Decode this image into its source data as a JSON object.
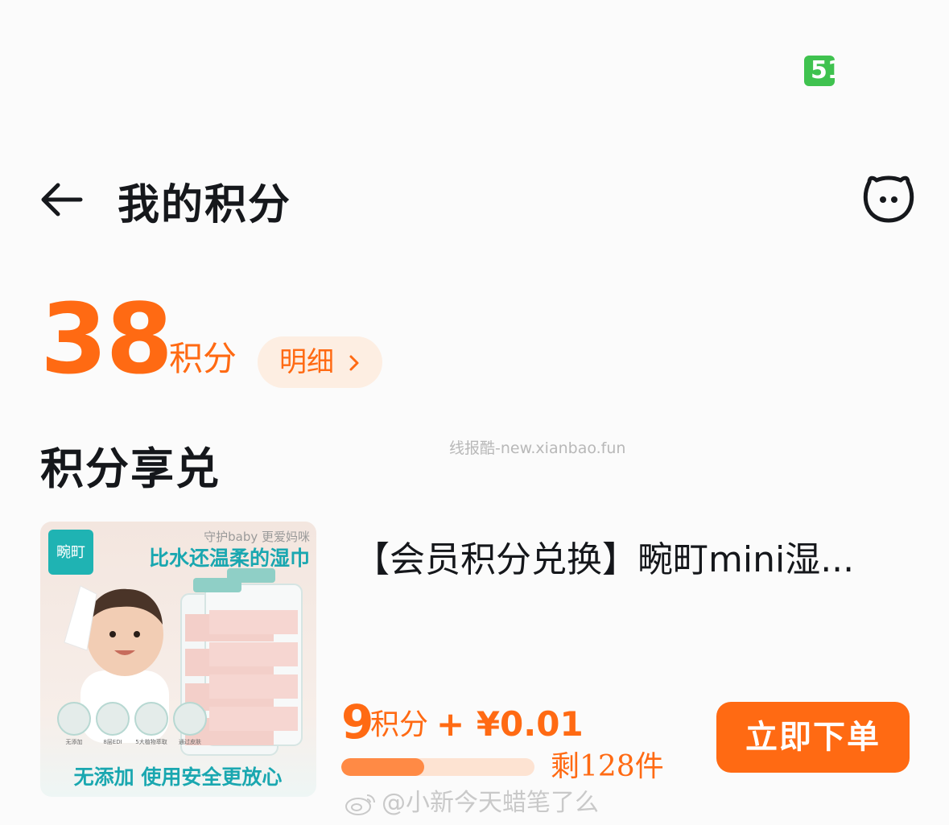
{
  "status_bar": {
    "badge": "51"
  },
  "header": {
    "title": "我的积分",
    "back_icon": "back-arrow-icon",
    "service_icon": "service-face-icon"
  },
  "points": {
    "value": "38",
    "unit": "积分",
    "detail_label": "明细"
  },
  "watermark_top": "线报酷-new.xianbao.fun",
  "section": {
    "title": "积分享兑"
  },
  "product": {
    "image_texts": {
      "brand": "畹町",
      "slogan": "守护baby 更爱妈咪",
      "headline": "比水还温柔的湿巾",
      "bottom": "无添加 使用安全更放心",
      "features": [
        "无添加\n安全抑菌成分",
        "8层EDI\n纯水过滤",
        "5大植物萃取\n温柔不易起皮",
        "通过皮肤\n刺激测试"
      ]
    },
    "name": "【会员积分兑换】畹町mini湿...",
    "price_points": "9",
    "price_points_unit": "积分",
    "price_cash": "+ ¥0.01",
    "stock_progress": 0.43,
    "stock_text": "剩128件",
    "order_label": "立即下单"
  },
  "watermark_bottom": "@小新今天蜡笔了么",
  "colors": {
    "accent": "#ff6a13",
    "accent_light": "#fdeee2",
    "badge_green": "#3fc24f"
  }
}
